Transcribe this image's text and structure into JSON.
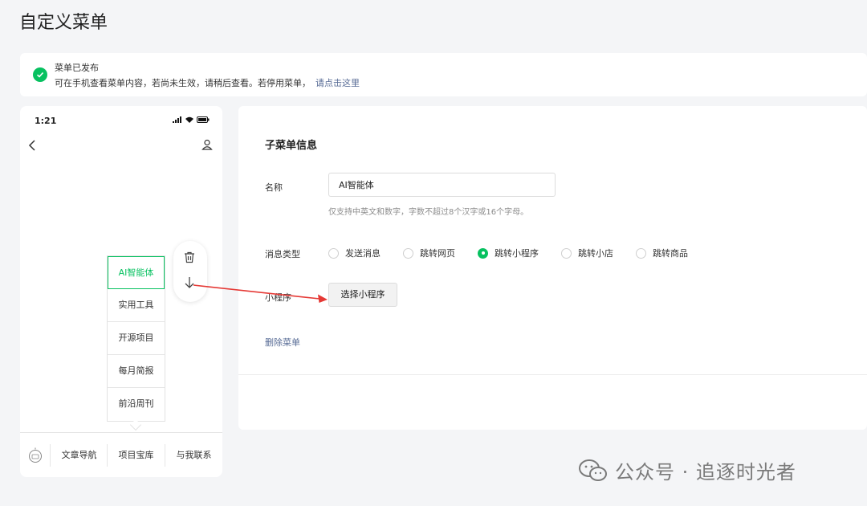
{
  "page": {
    "title": "自定义菜单"
  },
  "notice": {
    "title": "菜单已发布",
    "body": "可在手机查看菜单内容，若尚未生效，请稍后查看。若停用菜单，",
    "link": "请点击这里"
  },
  "phone": {
    "time": "1:21",
    "submenu": [
      "AI智能体",
      "实用工具",
      "开源项目",
      "每月简报",
      "前沿周刊"
    ],
    "active_submenu": "AI智能体",
    "bottom_tabs": [
      "文章导航",
      "项目宝库",
      "与我联系"
    ]
  },
  "editor": {
    "section_title": "子菜单信息",
    "name_label": "名称",
    "name_value": "AI智能体",
    "name_hint": "仅支持中英文和数字，字数不超过8个汉字或16个字母。",
    "type_label": "消息类型",
    "types": [
      "发送消息",
      "跳转网页",
      "跳转小程序",
      "跳转小店",
      "跳转商品"
    ],
    "selected_type": "跳转小程序",
    "miniprogram_label": "小程序",
    "pick_button": "选择小程序",
    "delete_link": "删除菜单"
  },
  "watermark": {
    "text": "公众号 · 追逐时光者"
  },
  "colors": {
    "accent": "#07c160",
    "link": "#576b95",
    "annotation_arrow": "#e53935"
  }
}
